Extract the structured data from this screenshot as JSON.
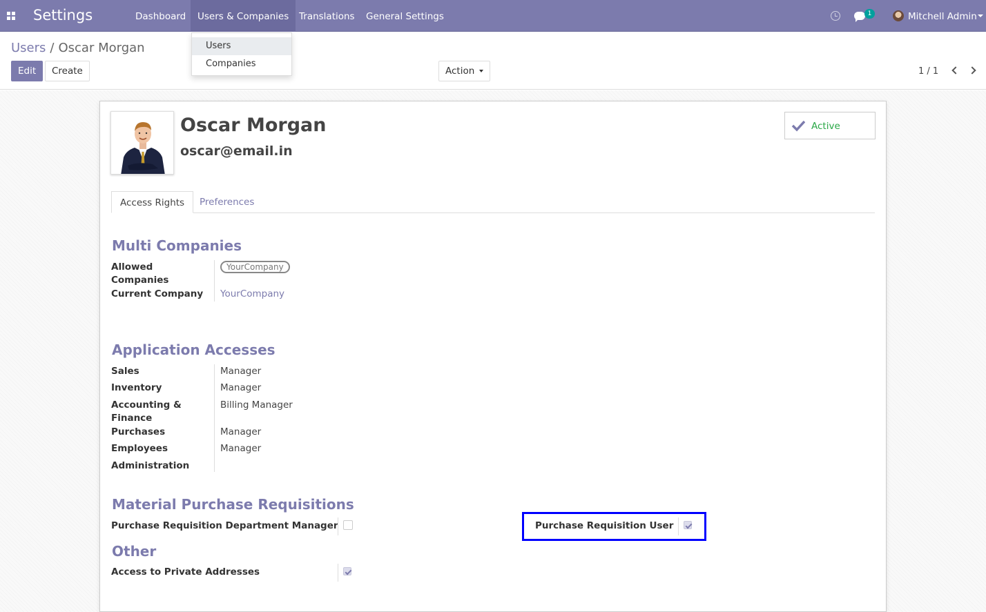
{
  "navbar": {
    "app_title": "Settings",
    "menu": [
      "Dashboard",
      "Users & Companies",
      "Translations",
      "General Settings"
    ],
    "chat_badge": "1",
    "user_name": "Mitchell Admin"
  },
  "dropdown": {
    "items": [
      "Users",
      "Companies"
    ]
  },
  "control_panel": {
    "breadcrumb_parent": "Users",
    "breadcrumb_sep": "/",
    "breadcrumb_current": "Oscar Morgan",
    "edit_label": "Edit",
    "create_label": "Create",
    "action_label": "Action",
    "pager_value": "1 / 1"
  },
  "record": {
    "name": "Oscar Morgan",
    "login": "oscar@email.in",
    "active_label": "Active"
  },
  "tabs": [
    "Access Rights",
    "Preferences"
  ],
  "multi_companies": {
    "title": "Multi Companies",
    "allowed_label": "Allowed Companies",
    "allowed_tag": "YourCompany",
    "current_label": "Current Company",
    "current_value": "YourCompany"
  },
  "application_accesses": {
    "title": "Application Accesses",
    "rows": [
      {
        "label": "Sales",
        "value": "Manager"
      },
      {
        "label": "Inventory",
        "value": "Manager"
      },
      {
        "label": "Accounting & Finance",
        "value": "Billing Manager"
      },
      {
        "label": "Purchases",
        "value": "Manager"
      },
      {
        "label": "Employees",
        "value": "Manager"
      },
      {
        "label": "Administration",
        "value": ""
      }
    ]
  },
  "material_purchase": {
    "title": "Material Purchase Requisitions",
    "dept_manager_label": "Purchase Requisition Department Manager",
    "dept_manager_checked": false,
    "user_label": "Purchase Requisition User",
    "user_checked": true
  },
  "other": {
    "title": "Other",
    "private_addresses_label": "Access to Private Addresses",
    "private_addresses_checked": true
  },
  "colors": {
    "brand": "#7c7bad",
    "active_green": "#28a745",
    "highlight": "#0000ff"
  }
}
